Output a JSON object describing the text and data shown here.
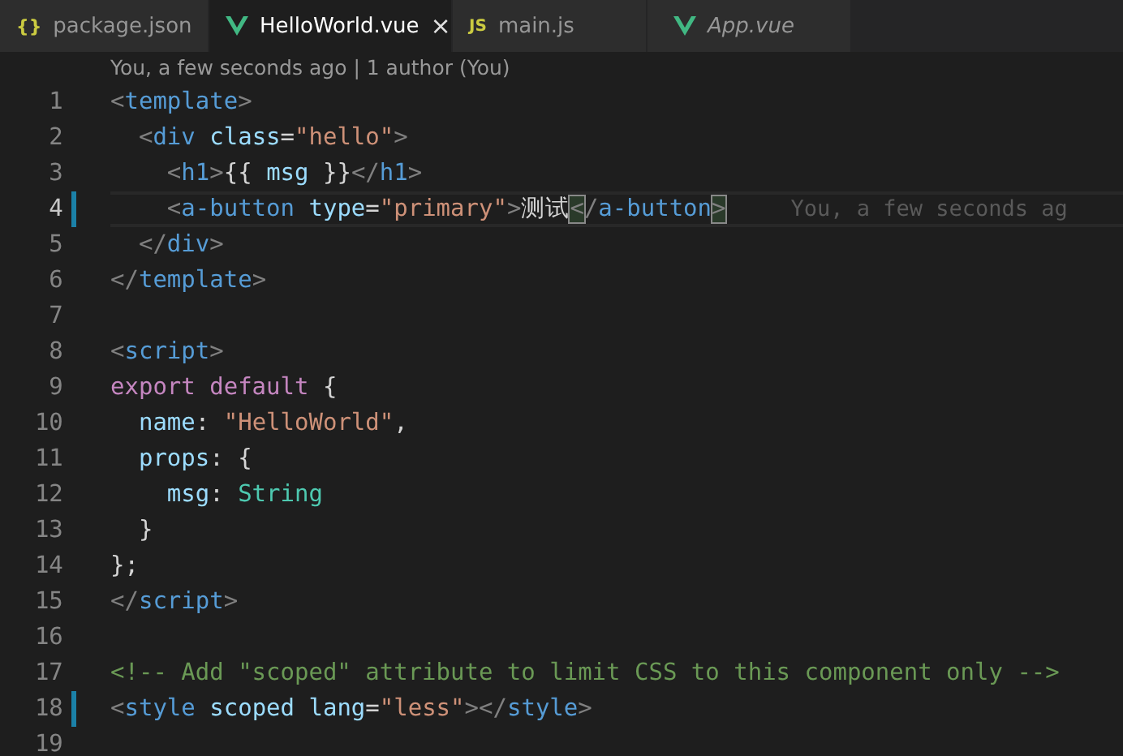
{
  "tabs": [
    {
      "label": "package.json",
      "kind": "json",
      "icon_text": "{}",
      "selected": false,
      "preview": false
    },
    {
      "label": "HelloWorld.vue",
      "kind": "vue",
      "selected": true,
      "preview": false,
      "close_text": "×"
    },
    {
      "label": "main.js",
      "kind": "js",
      "icon_text": "JS",
      "selected": false,
      "preview": false
    },
    {
      "label": "App.vue",
      "kind": "vue",
      "selected": false,
      "preview": true
    }
  ],
  "blame_header": "You, a few seconds ago | 1 author (You)",
  "lines": [
    {
      "number": "1",
      "modified": false,
      "current": false,
      "tokens": [
        {
          "kind": "punct",
          "text": "<"
        },
        {
          "kind": "tag",
          "text": "template"
        },
        {
          "kind": "punct",
          "text": ">"
        }
      ]
    },
    {
      "number": "2",
      "modified": false,
      "current": false,
      "tokens": [
        {
          "kind": "punct",
          "text": "  <"
        },
        {
          "kind": "tag",
          "text": "div "
        },
        {
          "kind": "attr",
          "text": "class"
        },
        {
          "kind": "plain",
          "text": "="
        },
        {
          "kind": "string",
          "text": "\"hello\""
        },
        {
          "kind": "punct",
          "text": ">"
        }
      ]
    },
    {
      "number": "3",
      "modified": false,
      "current": false,
      "tokens": [
        {
          "kind": "punct",
          "text": "    <"
        },
        {
          "kind": "tag",
          "text": "h1"
        },
        {
          "kind": "punct",
          "text": ">"
        },
        {
          "kind": "plain",
          "text": "{{ "
        },
        {
          "kind": "attr",
          "text": "msg "
        },
        {
          "kind": "plain",
          "text": "}}"
        },
        {
          "kind": "punct",
          "text": "</"
        },
        {
          "kind": "tag",
          "text": "h1"
        },
        {
          "kind": "punct",
          "text": ">"
        }
      ]
    },
    {
      "number": "4",
      "modified": true,
      "current": true,
      "blame": "You, a few seconds ag",
      "tokens": [
        {
          "kind": "punct",
          "text": "    <"
        },
        {
          "kind": "tag",
          "text": "a-button "
        },
        {
          "kind": "attr",
          "text": "type"
        },
        {
          "kind": "plain",
          "text": "="
        },
        {
          "kind": "string",
          "text": "\"primary\""
        },
        {
          "kind": "punct",
          "text": ">"
        },
        {
          "kind": "plain",
          "text": "测试"
        },
        {
          "kind": "match",
          "text": "<"
        },
        {
          "kind": "punct",
          "text": "/"
        },
        {
          "kind": "tag",
          "text": "a-button"
        },
        {
          "kind": "match",
          "text": ">"
        }
      ]
    },
    {
      "number": "5",
      "modified": false,
      "current": false,
      "tokens": [
        {
          "kind": "punct",
          "text": "  </"
        },
        {
          "kind": "tag",
          "text": "div"
        },
        {
          "kind": "punct",
          "text": ">"
        }
      ]
    },
    {
      "number": "6",
      "modified": false,
      "current": false,
      "tokens": [
        {
          "kind": "punct",
          "text": "</"
        },
        {
          "kind": "tag",
          "text": "template"
        },
        {
          "kind": "punct",
          "text": ">"
        }
      ]
    },
    {
      "number": "7",
      "modified": false,
      "current": false
    },
    {
      "number": "8",
      "modified": false,
      "current": false,
      "tokens": [
        {
          "kind": "punct",
          "text": "<"
        },
        {
          "kind": "tag",
          "text": "script"
        },
        {
          "kind": "punct",
          "text": ">"
        }
      ]
    },
    {
      "number": "9",
      "modified": false,
      "current": false,
      "tokens": [
        {
          "kind": "keyword",
          "text": "export default "
        },
        {
          "kind": "plain",
          "text": "{"
        }
      ]
    },
    {
      "number": "10",
      "modified": false,
      "current": false,
      "tokens": [
        {
          "kind": "attr",
          "text": "  name"
        },
        {
          "kind": "plain",
          "text": ": "
        },
        {
          "kind": "string",
          "text": "\"HelloWorld\""
        },
        {
          "kind": "plain",
          "text": ","
        }
      ]
    },
    {
      "number": "11",
      "modified": false,
      "current": false,
      "tokens": [
        {
          "kind": "attr",
          "text": "  props"
        },
        {
          "kind": "plain",
          "text": ": {"
        }
      ]
    },
    {
      "number": "12",
      "modified": false,
      "current": false,
      "tokens": [
        {
          "kind": "attr",
          "text": "    msg"
        },
        {
          "kind": "plain",
          "text": ": "
        },
        {
          "kind": "type",
          "text": "String"
        }
      ]
    },
    {
      "number": "13",
      "modified": false,
      "current": false,
      "tokens": [
        {
          "kind": "plain",
          "text": "  }"
        }
      ]
    },
    {
      "number": "14",
      "modified": false,
      "current": false,
      "tokens": [
        {
          "kind": "plain",
          "text": "};"
        }
      ]
    },
    {
      "number": "15",
      "modified": false,
      "current": false,
      "tokens": [
        {
          "kind": "punct",
          "text": "</"
        },
        {
          "kind": "tag",
          "text": "script"
        },
        {
          "kind": "punct",
          "text": ">"
        }
      ]
    },
    {
      "number": "16",
      "modified": false,
      "current": false
    },
    {
      "number": "17",
      "modified": false,
      "current": false,
      "tokens": [
        {
          "kind": "comment",
          "text": "<!-- Add \"scoped\" attribute to limit CSS to this component only -->"
        }
      ]
    },
    {
      "number": "18",
      "modified": true,
      "current": false,
      "tokens": [
        {
          "kind": "punct",
          "text": "<"
        },
        {
          "kind": "tag",
          "text": "style "
        },
        {
          "kind": "attr",
          "text": "scoped lang"
        },
        {
          "kind": "plain",
          "text": "="
        },
        {
          "kind": "string",
          "text": "\"less\""
        },
        {
          "kind": "punct",
          "text": "></"
        },
        {
          "kind": "tag",
          "text": "style"
        },
        {
          "kind": "punct",
          "text": ">"
        }
      ]
    },
    {
      "number": "19",
      "modified": false,
      "current": false
    }
  ]
}
